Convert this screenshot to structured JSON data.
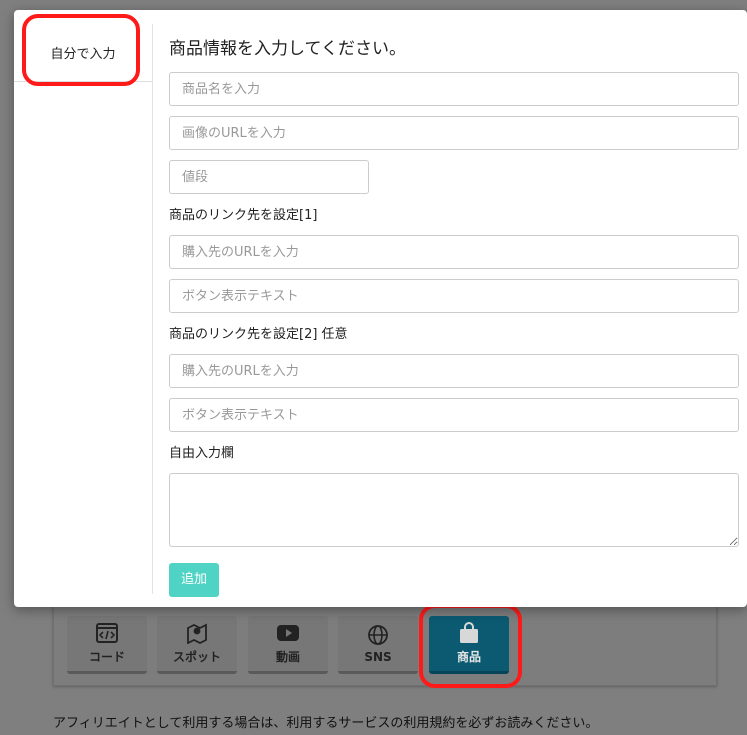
{
  "background": {
    "footer_note": "アフィリエイトとして利用する場合は、利用するサービスの利用規約を必ずお読みください。",
    "blocks": [
      {
        "label": "コード",
        "icon": "code-icon"
      },
      {
        "label": "スポット",
        "icon": "map-pin-icon"
      },
      {
        "label": "動画",
        "icon": "youtube-icon"
      },
      {
        "label": "SNS",
        "icon": "globe-icon"
      },
      {
        "label": "商品",
        "icon": "shopping-bag-icon"
      }
    ]
  },
  "modal": {
    "tabs": [
      {
        "label": "自分で入力"
      }
    ],
    "title": "商品情報を入力してください。",
    "fields": {
      "product_name": {
        "placeholder": "商品名を入力",
        "value": ""
      },
      "image_url": {
        "placeholder": "画像のURLを入力",
        "value": ""
      },
      "price": {
        "placeholder": "値段",
        "value": ""
      },
      "link1_url": {
        "placeholder": "購入先のURLを入力",
        "value": ""
      },
      "link1_text": {
        "placeholder": "ボタン表示テキスト",
        "value": ""
      },
      "link2_url": {
        "placeholder": "購入先のURLを入力",
        "value": ""
      },
      "link2_text": {
        "placeholder": "ボタン表示テキスト",
        "value": ""
      },
      "free_text": {
        "placeholder": "",
        "value": ""
      }
    },
    "labels": {
      "link1": "商品のリンク先を設定[1]",
      "link2": "商品のリンク先を設定[2] 任意",
      "free": "自由入力欄"
    },
    "add_button": "追加"
  },
  "colors": {
    "accent": "#4fd3c4",
    "active_block": "#0b5a72",
    "highlight_ring": "#ff1a1a"
  }
}
